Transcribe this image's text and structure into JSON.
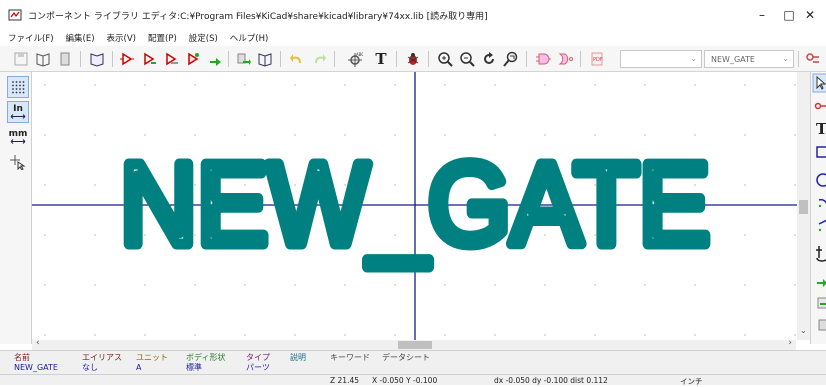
{
  "window": {
    "title": "コンポーネント ライブラリ エディタ:C:¥Program Files¥KiCad¥share¥kicad¥library¥74xx.lib [読み取り専用]",
    "controls": {
      "minimize": "–",
      "maximize": "□",
      "close": "✕"
    }
  },
  "menu": [
    "ファイル(F)",
    "編集(E)",
    "表示(V)",
    "配置(P)",
    "設定(S)",
    "ヘルプ(H)"
  ],
  "toolbar": {
    "icons": [
      "save-library-icon",
      "library-browse-icon",
      "library-icon",
      "component-browse-icon",
      "new-component-icon",
      "import-component-icon",
      "export-component-icon",
      "create-component-icon",
      "save-component-icon",
      "copy-component-icon",
      "library-docs-icon",
      "undo-icon",
      "redo-icon",
      "pin-table-icon",
      "text-icon",
      "bug-check-icon",
      "zoom-in-icon",
      "zoom-out-icon",
      "redraw-icon",
      "zoom-fit-icon",
      "normal-style-icon",
      "demorgan-style-icon",
      "datasheet-icon"
    ],
    "part_combo_value": "",
    "alias_combo_value": "NEW_GATE",
    "settings_icon": "pin-settings-icon"
  },
  "left_toolbar": {
    "grid_icon": "grid-icon",
    "inch_label": "In",
    "mm_label": "mm",
    "cursor_icon": "cursor-shape-icon"
  },
  "canvas": {
    "component_text": "NEW_GATE",
    "text_color": "#008080",
    "axis_color": "#1a1a8a"
  },
  "info_panel": {
    "columns": [
      {
        "label": "名前",
        "value": "NEW_GATE",
        "label_color": "#7a2020"
      },
      {
        "label": "エイリアス",
        "value": "なし",
        "label_color": "#7a2020"
      },
      {
        "label": "ユニット",
        "value": "A",
        "label_color": "#8a6a00"
      },
      {
        "label": "ボディ形状",
        "value": "標準",
        "label_color": "#2a7a2a"
      },
      {
        "label": "タイプ",
        "value": "パーツ",
        "label_color": "#7a2070"
      },
      {
        "label": "説明",
        "value": "",
        "label_color": "#1a6a8a"
      },
      {
        "label": "キーワード",
        "value": "",
        "label_color": "#444444"
      },
      {
        "label": "データシート",
        "value": "",
        "label_color": "#444444"
      }
    ]
  },
  "status": {
    "zoom": "Z 21.45",
    "xy": "X -0.050  Y -0.100",
    "delta": "dx -0.050  dy -0.100  dist 0.112",
    "units": "インチ"
  }
}
